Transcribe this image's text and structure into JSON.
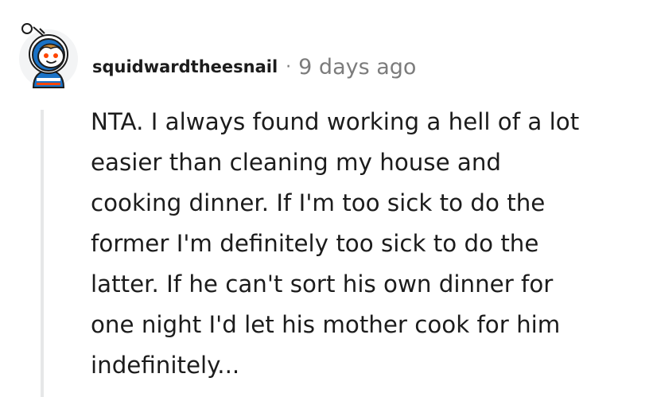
{
  "comment": {
    "author": "squidwardtheesnail",
    "separator": "·",
    "timestamp": "9 days ago",
    "body_lines": [
      "NTA. I always found working a hell of a lot",
      "easier than cleaning my house and",
      "cooking dinner. If I'm too sick to do the",
      "former I'm definitely too sick to do the",
      "latter. If he can't sort his own dinner for",
      "one night I'd let his mother cook for him",
      "indefinitely..."
    ]
  },
  "colors": {
    "text": "#1c1c1c",
    "meta_gray": "#7c7c7c",
    "thread_line": "#e6e7e8",
    "avatar_bg": "#f3f4f5",
    "avatar_blue": "#1a72c6",
    "avatar_orange": "#ff4500"
  },
  "icons": {
    "avatar": "snoo-avatar-icon"
  }
}
